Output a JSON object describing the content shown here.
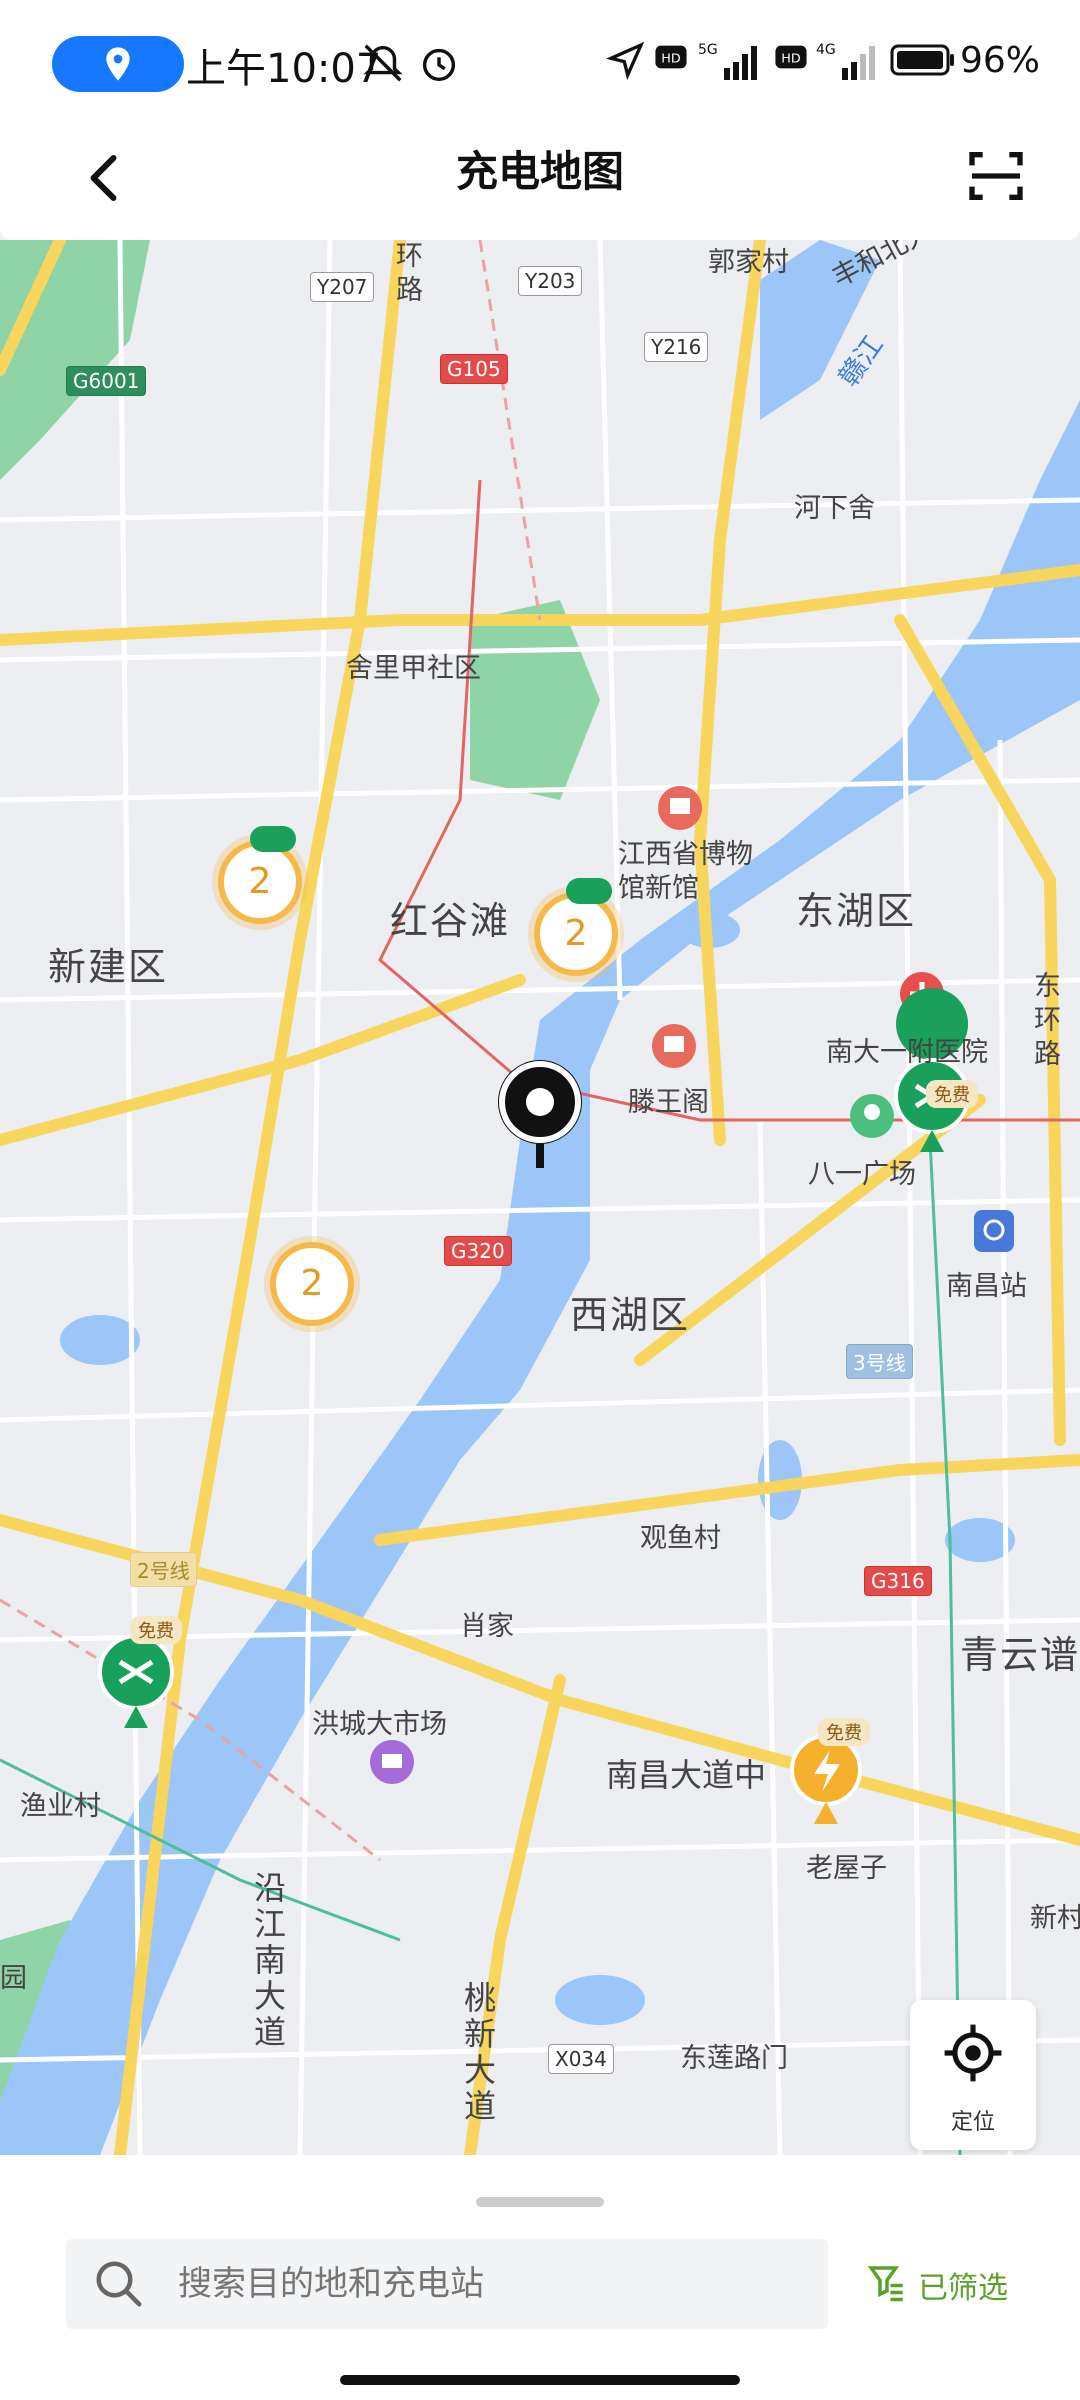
{
  "status_bar": {
    "time": "上午10:07",
    "battery": "96%",
    "network_1": "5G",
    "network_2": "4G",
    "hd": "HD"
  },
  "header": {
    "title": "充电地图"
  },
  "map": {
    "districts": [
      "红谷滩",
      "新建区",
      "东湖区",
      "西湖区",
      "青云谱"
    ],
    "places": [
      "舍里甲社区",
      "江西省博物馆新馆",
      "滕王阁",
      "南大一附医院",
      "八一广场",
      "南昌站",
      "观鱼村",
      "肖家",
      "洪城大市场",
      "南昌大道中",
      "老屋子",
      "渔业村",
      "东莲路门",
      "沿江南大道",
      "桃新大道",
      "河下舍",
      "环路",
      "郭家村",
      "丰和北大道",
      "赣江",
      "东环路",
      "新村",
      "园"
    ],
    "roads": [
      "Y207",
      "Y203",
      "G105",
      "Y216",
      "G6001",
      "G320",
      "G316",
      "X034",
      "3号线",
      "2号线"
    ],
    "clusters": [
      "2",
      "2",
      "2"
    ],
    "free_label": "免费"
  },
  "locate": {
    "label": "定位"
  },
  "search": {
    "placeholder": "搜索目的地和充电站"
  },
  "filter": {
    "label": "已筛选"
  },
  "colors": {
    "accent": "#1677ff",
    "water": "#9bc6f7",
    "park": "#8fd4a7",
    "road_major": "#f8d55c",
    "charger_green": "#19a05b",
    "cluster_orange": "#f5b94a",
    "filter_green": "#5aa12a"
  }
}
